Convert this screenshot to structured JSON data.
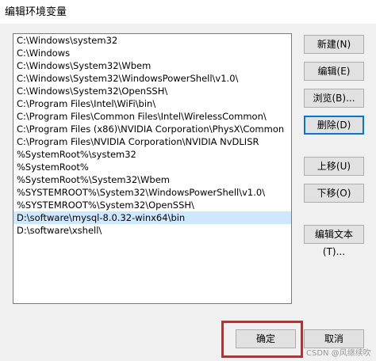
{
  "window": {
    "title": "编辑环境变量"
  },
  "paths": [
    "C:\\Windows\\system32",
    "C:\\Windows",
    "C:\\Windows\\System32\\Wbem",
    "C:\\Windows\\System32\\WindowsPowerShell\\v1.0\\",
    "C:\\Windows\\System32\\OpenSSH\\",
    "C:\\Program Files\\Intel\\WiFi\\bin\\",
    "C:\\Program Files\\Common Files\\Intel\\WirelessCommon\\",
    "C:\\Program Files (x86)\\NVIDIA Corporation\\PhysX\\Common",
    "C:\\Program Files\\NVIDIA Corporation\\NVIDIA NvDLISR",
    "%SystemRoot%\\system32",
    "%SystemRoot%",
    "%SystemRoot%\\System32\\Wbem",
    "%SYSTEMROOT%\\System32\\WindowsPowerShell\\v1.0\\",
    "%SYSTEMROOT%\\System32\\OpenSSH\\",
    "D:\\software\\mysql-8.0.32-winx64\\bin",
    "D:\\software\\xshell\\"
  ],
  "selected_index": 14,
  "buttons": {
    "new": "新建(N)",
    "edit": "编辑(E)",
    "browse": "浏览(B)...",
    "delete": "删除(D)",
    "move_up": "上移(U)",
    "move_down": "下移(O)",
    "edit_text": "编辑文本(T)...",
    "ok": "确定",
    "cancel": "取消"
  },
  "watermark": "CSDN @风继续吹",
  "colors": {
    "highlight": "#e02020",
    "selection": "#cce8ff",
    "focus": "#0078d7"
  }
}
